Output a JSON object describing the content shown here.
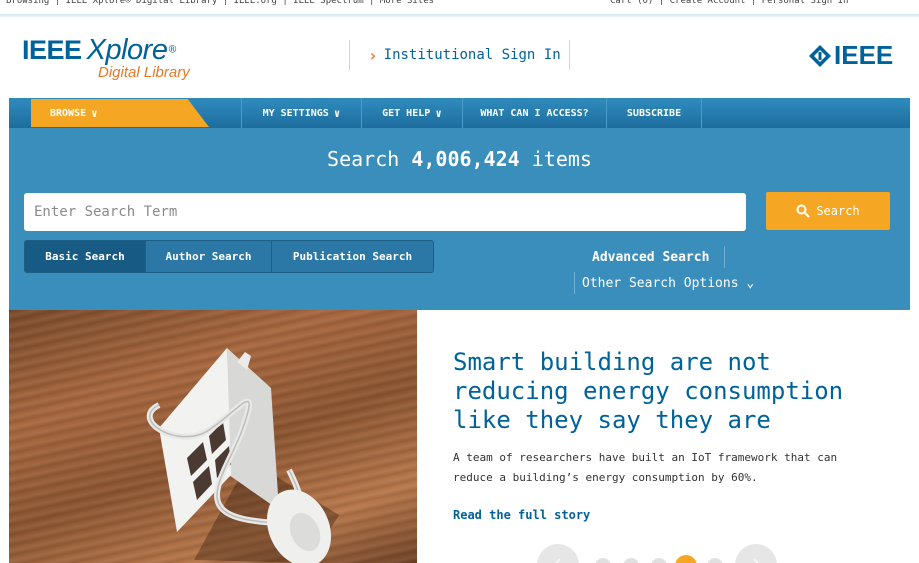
{
  "topbar": {
    "left_text": "Browsing | IEEE Xplore® Digital Library | IEEE.org | IEEE Spectrum | More Sites",
    "right_text": "Cart (0) | Create Account | Personal Sign In"
  },
  "header": {
    "logo_main": "IEEE",
    "logo_xplore": "Xplore",
    "logo_reg": "®",
    "logo_sub": "Digital Library",
    "signin_label": "Institutional Sign In",
    "ieee_logo_text": "IEEE"
  },
  "nav": {
    "browse": "BROWSE",
    "my_settings": "MY SETTINGS",
    "get_help": "GET HELP",
    "what_can_i_access": "WHAT CAN I ACCESS?",
    "subscribe": "SUBSCRIBE"
  },
  "search": {
    "count_prefix": "Search",
    "count_value": "4,006,424",
    "count_suffix": "items",
    "placeholder": "Enter Search Term",
    "button_label": "Search",
    "tabs": [
      "Basic Search",
      "Author Search",
      "Publication Search"
    ],
    "active_tab": 0,
    "advanced_label": "Advanced Search",
    "other_options_label": "Other Search Options"
  },
  "hero": {
    "title": "Smart building are not reducing energy consumption like they say they are",
    "description": "A team of researchers have built an IoT framework that can reduce a building’s energy consumption by 60%.",
    "link_label": "Read the full story",
    "carousel_dots": 5,
    "active_dot": 3
  },
  "colors": {
    "brand_blue": "#00629b",
    "accent_orange": "#f5a623",
    "panel_blue": "#3a8ebb"
  }
}
